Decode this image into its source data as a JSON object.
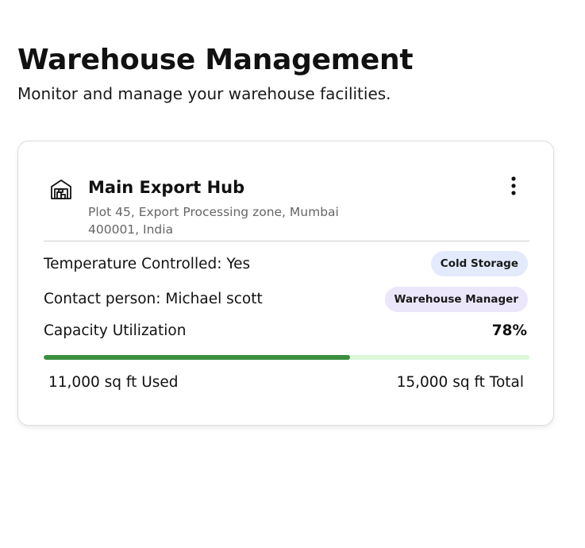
{
  "header": {
    "title": "Warehouse Management",
    "subtitle": "Monitor and manage your warehouse facilities."
  },
  "warehouse": {
    "name": "Main Export Hub",
    "address": "Plot 45, Export Processing zone, Mumbai 400001, India",
    "icon": "warehouse-icon",
    "menu_icon": "more-vertical-icon",
    "temperature_label": "Temperature Controlled: Yes",
    "storage_badge": "Cold Storage",
    "contact_label": "Contact person: Michael scott",
    "role_badge": "Warehouse Manager",
    "capacity_label": "Capacity Utilization",
    "capacity_percent_text": "78%",
    "capacity_fill_fraction": 0.63,
    "used_label": "11,000 sq ft Used",
    "total_label": "15,000 sq ft Total"
  },
  "colors": {
    "progress_fill": "#3b8f3f",
    "progress_track": "#dcf8d9",
    "cold_badge_bg": "#e3eafb",
    "manager_badge_bg": "#ece6fa"
  }
}
